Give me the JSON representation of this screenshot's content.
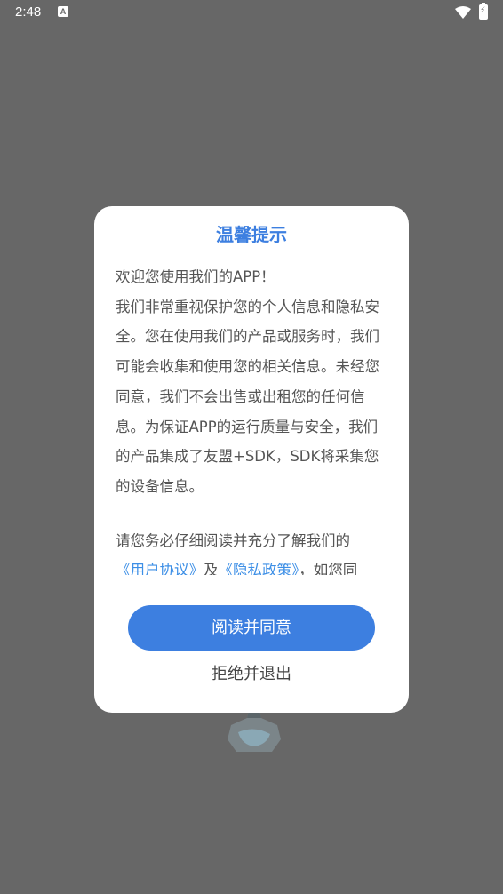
{
  "status_bar": {
    "time": "2:48",
    "notification_icon_letter": "A",
    "icons": [
      "a-notification-icon",
      "wifi-icon",
      "battery-charging-icon"
    ]
  },
  "background": {
    "color": "#676767",
    "decoration": "bottle-icon"
  },
  "dialog": {
    "title": "温馨提示",
    "body": {
      "line1": "欢迎您使用我们的APP！",
      "line2": "我们非常重视保护您的个人信息和隐私安全。您在使用我们的产品或服务时，我们可能会收集和使用您的相关信息。未经您同意，我们不会出售或出租您的任何信息。为保证APP的运行质量与安全，我们的产品集成了友盟+SDK，SDK将采集您的设备信息。",
      "line3": "请您务必仔细阅读并充分了解我们的",
      "user_agreement_link": "《用户协议》",
      "and_text": "及",
      "privacy_policy_link": "《隐私政策》",
      "tail_text": "，如您同"
    },
    "agree_button": "阅读并同意",
    "reject_button": "拒绝并退出"
  },
  "colors": {
    "accent": "#3d7fe0",
    "link": "#3d8fe6",
    "overlay": "#676767",
    "body_text": "#555555"
  }
}
